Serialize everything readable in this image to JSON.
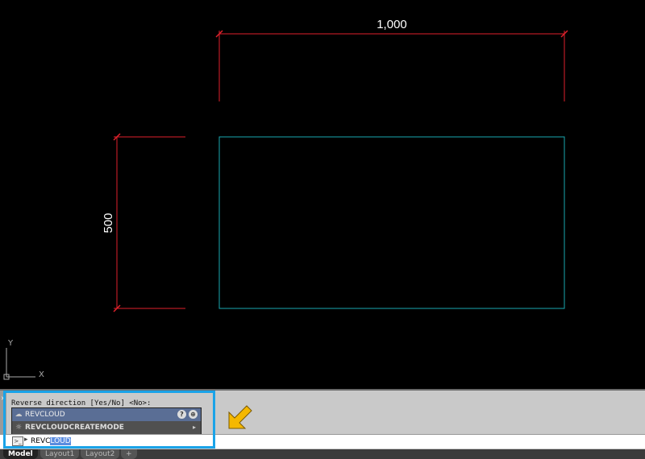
{
  "drawing": {
    "horizontal_dimension": "1,000",
    "vertical_dimension": "500",
    "ucs_y": "Y",
    "ucs_x": "X",
    "colors": {
      "dimension": "#e0212b",
      "rectangle": "#1aa7b0",
      "background": "#000000"
    }
  },
  "command_line": {
    "history": "Reverse direction [Yes/No] <No>:",
    "autocomplete": {
      "items": [
        {
          "label": "REVCLOUD",
          "icon": "revcloud-icon",
          "selected": true
        },
        {
          "label": "REVCLOUDCREATEMODE",
          "icon": "sysvar-gear-icon",
          "selected": false
        }
      ]
    },
    "input_typed": "REVC",
    "input_suggested": "LOUD",
    "prompt_symbol": "▸"
  },
  "layout_tabs": [
    "Model",
    "Layout1",
    "Layout2",
    "+"
  ],
  "annotation": {
    "highlight_color": "#1aa3e8",
    "arrow_color": "#f5b800"
  }
}
